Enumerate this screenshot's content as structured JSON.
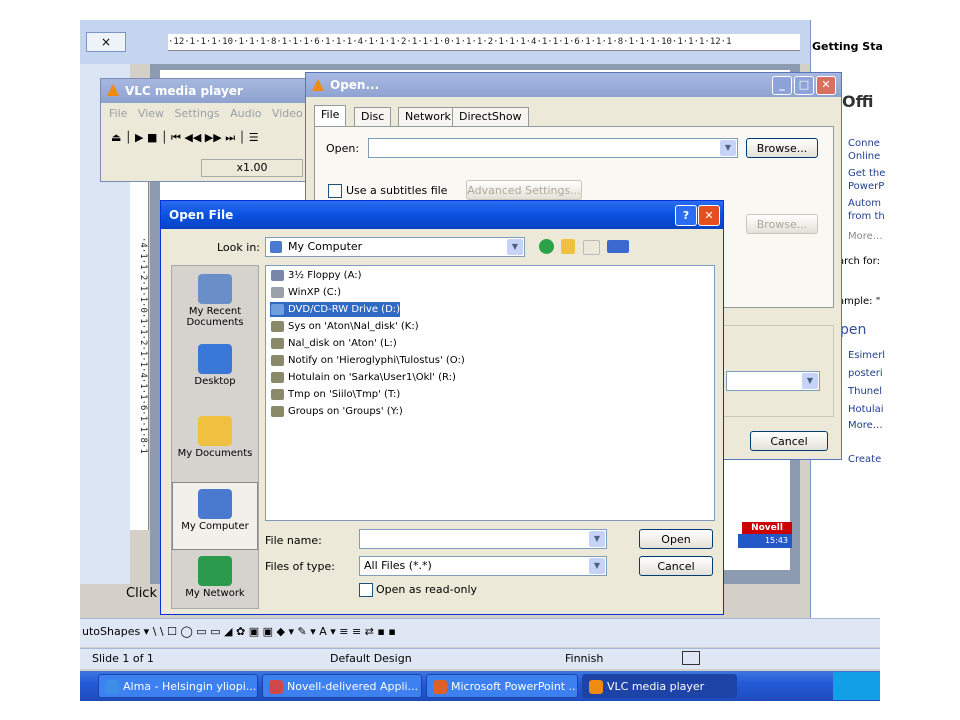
{
  "powerpoint": {
    "ruler_h": "·12·1·1·1·10·1·1·1·8·1·1·1·6·1·1·1·4·1·1·1·2·1·1·1·0·1·1·1·2·1·1·1·4·1·1·1·6·1·1·1·8·1·1·1·10·1·1·1·12·1",
    "ruler_v": "·4·1·1·2·1·1·0·1·1·2·1·1·4·1·1·6·1·1·8·1",
    "tab_close": "×",
    "task_pane": {
      "title": "Getting Sta",
      "logo": "Offi",
      "links": [
        "Conne",
        "Online",
        "Get the",
        "PowerP",
        "Autom",
        "from th",
        "More…",
        "arch for:",
        "ample: \"",
        "Esimerl",
        "posteri",
        "Thunel",
        "Hotulai",
        "More…",
        "Create"
      ],
      "open_heading": "pen"
    },
    "click_hint": "Click",
    "novell_badge": "Novell",
    "clock": "15:43",
    "drawing_toolbar": "utoShapes ▾  \\  \\  ☐  ◯  ▭  ▭  ◢  ✿  ▣  ▣  ◆ ▾  ✎ ▾  A ▾  ≡  ≡  ⇄  ▪  ▪",
    "status": {
      "slide": "Slide 1 of 1",
      "design": "Default Design",
      "language": "Finnish"
    }
  },
  "taskbar": {
    "items": [
      {
        "label": "Alma - Helsingin yliopi...",
        "color": "#3b8de8"
      },
      {
        "label": "Novell-delivered Appli...",
        "color": "#d04848"
      },
      {
        "label": "Microsoft PowerPoint ...",
        "color": "#e0602a"
      },
      {
        "label": "VLC media player",
        "color": "#f08a10"
      }
    ]
  },
  "vlc": {
    "title": "VLC media player",
    "menu": [
      "File",
      "View",
      "Settings",
      "Audio",
      "Video"
    ],
    "controls": "⏏ │ ▶  ■  │ ⏮  ◀◀  ▶▶  ⏭ │ ☰",
    "rate": "x1.00"
  },
  "open_dialog": {
    "title": "Open...",
    "tabs": [
      "File",
      "Disc",
      "Network",
      "DirectShow"
    ],
    "open_label": "Open:",
    "open_value": "",
    "browse_label": "Browse...",
    "subtitles_label": "Use a subtitles file",
    "advanced_label": "Advanced Settings...",
    "browse2_label": "Browse...",
    "cancel_label": "Cancel"
  },
  "open_file": {
    "title": "Open File",
    "look_in_label": "Look in:",
    "look_in_value": "My Computer",
    "places": [
      {
        "label": "My Recent Documents",
        "color": "#6a8fc8"
      },
      {
        "label": "Desktop",
        "color": "#3a78d8"
      },
      {
        "label": "My Documents",
        "color": "#f0c040"
      },
      {
        "label": "My Computer",
        "color": "#4a7ad0"
      },
      {
        "label": "My Network",
        "color": "#2c9a4c"
      }
    ],
    "files": [
      {
        "name": "3½ Floppy (A:)",
        "color": "#7a86a8"
      },
      {
        "name": "WinXP (C:)",
        "color": "#9aa0aa"
      },
      {
        "name": "DVD/CD-RW Drive (D:)",
        "color": "#6f9fe0"
      },
      {
        "name": "Sys on 'Aton\\Nal_disk' (K:)",
        "color": "#8a8a6a"
      },
      {
        "name": "Nal_disk on 'Aton' (L:)",
        "color": "#8a8a6a"
      },
      {
        "name": "Notify on 'Hieroglyphi\\Tulostus' (O:)",
        "color": "#8a8a6a"
      },
      {
        "name": "Hotulain on 'Sarka\\User1\\Okl' (R:)",
        "color": "#8a8a6a"
      },
      {
        "name": "Tmp on 'Siilo\\Tmp' (T:)",
        "color": "#8a8a6a"
      },
      {
        "name": "Groups on 'Groups' (Y:)",
        "color": "#8a8a6a"
      }
    ],
    "filename_label": "File name:",
    "filename_value": "",
    "filetype_label": "Files of type:",
    "filetype_value": "All Files (*.*)",
    "readonly_label": "Open as read-only",
    "open_btn": "Open",
    "cancel_btn": "Cancel",
    "help_btn": "?",
    "close_btn": "✕"
  }
}
